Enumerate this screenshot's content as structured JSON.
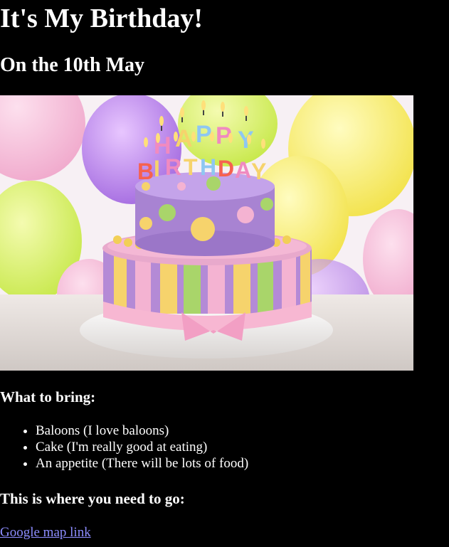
{
  "page": {
    "title": "It's My Birthday!",
    "subtitle": "On the 10th May",
    "image_alt": "Birthday cake with candles",
    "bring_heading": "What to bring:",
    "bring_items": [
      "Baloons (I love baloons)",
      "Cake (I'm really good at eating)",
      "An appetite (There will be lots of food)"
    ],
    "go_heading": "This is where you need to go:",
    "map_link": "Google map link"
  },
  "cake": {
    "candles_top": [
      "H",
      "A",
      "P",
      "P",
      "Y"
    ],
    "candles_bottom": [
      "B",
      "I",
      "R",
      "T",
      "H",
      "D",
      "A",
      "Y"
    ]
  },
  "colors": {
    "background": "#000000",
    "text": "#ffffff",
    "link": "#8d8dff"
  }
}
